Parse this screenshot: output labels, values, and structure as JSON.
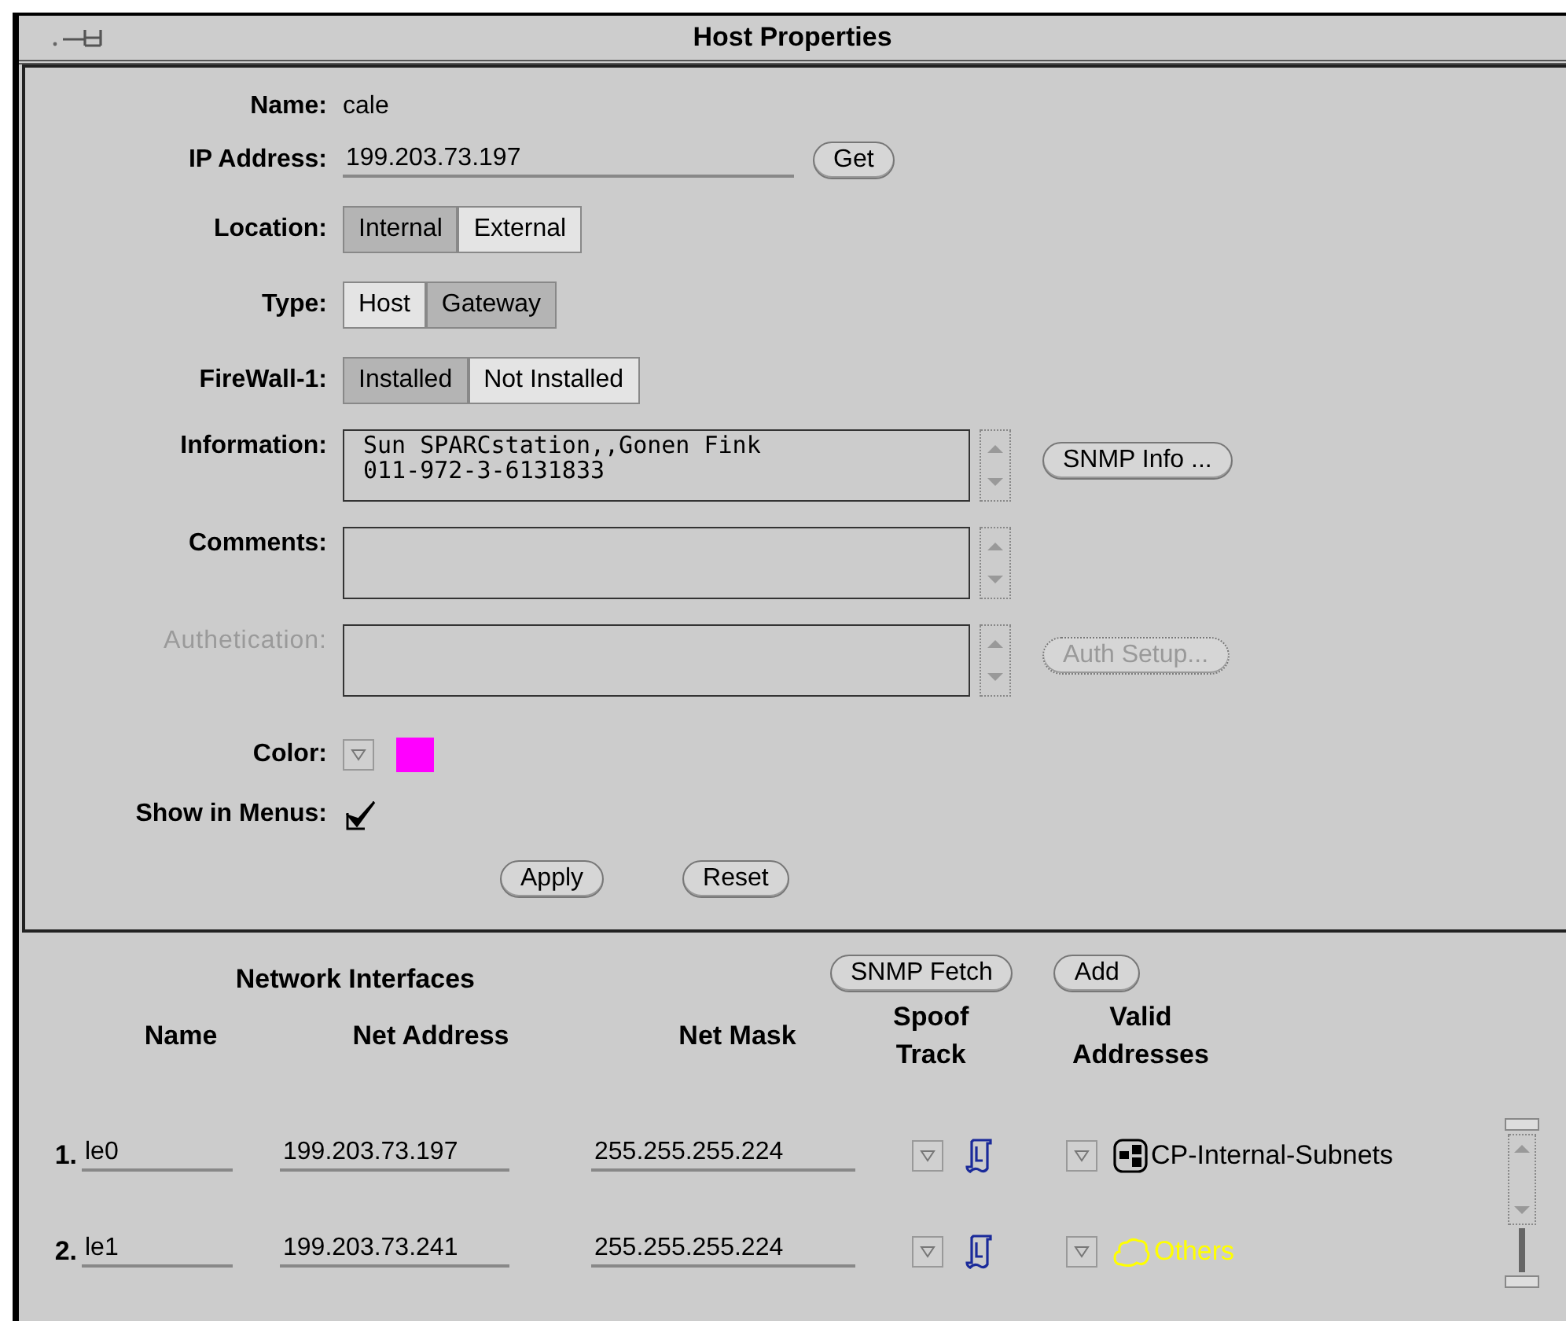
{
  "window": {
    "title": "Host Properties"
  },
  "form": {
    "name": {
      "label": "Name:",
      "value": "cale"
    },
    "ip_address": {
      "label": "IP Address:",
      "value": "199.203.73.197",
      "button": "Get"
    },
    "choices": [
      {
        "label": "Location:",
        "options": [
          {
            "label": "Internal",
            "selected": true
          },
          {
            "label": "External",
            "selected": false
          }
        ]
      },
      {
        "label": "Type:",
        "options": [
          {
            "label": "Host",
            "selected": false
          },
          {
            "label": "Gateway",
            "selected": true
          }
        ]
      },
      {
        "label": "FireWall-1:",
        "options": [
          {
            "label": "Installed",
            "selected": true
          },
          {
            "label": "Not Installed",
            "selected": false
          }
        ]
      }
    ],
    "text_areas": [
      {
        "label": "Information:",
        "value": "Sun SPARCstation,,Gonen Fink\n011-972-3-6131833",
        "disabled": false,
        "button": {
          "label": "SNMP Info ...",
          "disabled": false
        }
      },
      {
        "label": "Comments:",
        "disabled": false
      },
      {
        "label": "Authetication:",
        "disabled": true,
        "button": {
          "label": "Auth Setup...",
          "disabled": true
        }
      }
    ],
    "color": {
      "label": "Color:",
      "color": "#ff00ff"
    },
    "show_in_menus": {
      "label": "Show in Menus:",
      "checked": true
    },
    "buttons": [
      "Apply",
      "Reset"
    ]
  },
  "network_interfaces": {
    "title": "Network Interfaces",
    "buttons": [
      "SNMP Fetch",
      "Add"
    ],
    "columns": [
      "Name",
      "Net Address",
      "Net Mask",
      "Spoof\nTrack",
      "Valid\nAddresses"
    ],
    "rows": [
      {
        "index": "1.",
        "name": "le0",
        "net_address": "199.203.73.197",
        "net_mask": "255.255.255.224",
        "valid_addresses": {
          "kind": "group",
          "label": "CP-Internal-Subnets",
          "color": "#000000"
        }
      },
      {
        "index": "2.",
        "name": "le1",
        "net_address": "199.203.73.241",
        "net_mask": "255.255.255.224",
        "valid_addresses": {
          "kind": "cloud",
          "label": "Others",
          "color": "#ffff00"
        }
      }
    ]
  }
}
